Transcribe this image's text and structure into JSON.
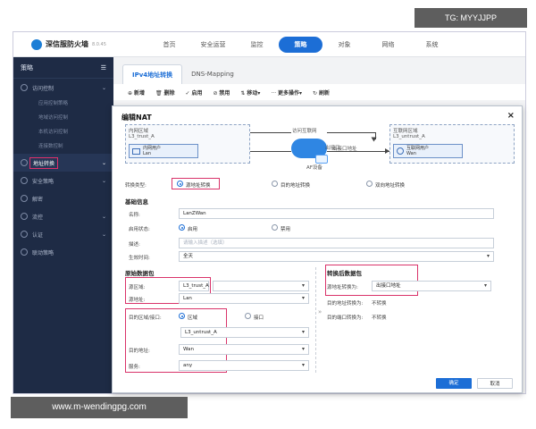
{
  "watermarks": {
    "top_right": "TG: MYYJJPP",
    "bottom_left": "www.m-wendingpg.com"
  },
  "app": {
    "title": "深信服防火墙",
    "version": "8.0.45"
  },
  "topnav": [
    "首页",
    "安全运营",
    "监控",
    "策略",
    "对象",
    "网络",
    "系统"
  ],
  "sidebar": {
    "title": "策略",
    "items": [
      {
        "label": "访问控制",
        "icon": "shield-icon"
      },
      {
        "label": "地址转换",
        "icon": "swap-icon"
      },
      {
        "label": "安全策略",
        "icon": "lock-icon"
      },
      {
        "label": "解密",
        "icon": "key-icon"
      },
      {
        "label": "流控",
        "icon": "gauge-icon"
      },
      {
        "label": "认证",
        "icon": "user-icon"
      },
      {
        "label": "联动策略",
        "icon": "link-icon"
      }
    ],
    "subitems": [
      "应用控制策略",
      "地域访问控制",
      "本机访问控制",
      "连接数控制"
    ]
  },
  "tabs": [
    "IPv4地址转换",
    "DNS-Mapping"
  ],
  "toolbar": [
    "新增",
    "删除",
    "启用",
    "禁用",
    "移动",
    "更多操作",
    "刷新"
  ],
  "modal": {
    "title": "编辑NAT",
    "close": "×",
    "diagram": {
      "src_zone_title": "内网区域",
      "src_zone": "L3_trust_A",
      "src_user": "内网用户",
      "src_user_val": "Lan",
      "dst_zone_title": "互联网区域",
      "dst_zone": "L3_untrust_A",
      "dst_user": "互联网用户",
      "dst_user_val": "Wan",
      "top_text": "访问互联网",
      "outlet": "出接口",
      "device": "AF设备",
      "out_addr": "出接口地址"
    },
    "conversion": {
      "label": "转换类型:",
      "options": [
        "源地址转换",
        "目的地址转换",
        "双向地址转换"
      ],
      "selected": "源地址转换"
    },
    "basic": {
      "section": "基础信息",
      "name_label": "名称:",
      "name_value": "LanZWan",
      "status_label": "启用状态:",
      "status_options": [
        "启用",
        "禁用"
      ],
      "desc_label": "描述:",
      "desc_placeholder": "请输入描述（选填）",
      "time_label": "生效时间:",
      "time_value": "全天"
    },
    "original": {
      "section": "原始数据包",
      "src_zone_label": "源区域:",
      "src_zone_value": "L3_trust_A",
      "src_addr_label": "源地址:",
      "src_addr_value": "Lan",
      "dst_type_label": "目的区域/接口:",
      "dst_type_options": [
        "区域",
        "接口"
      ],
      "dst_zone_value": "L3_untrust_A",
      "dst_addr_label": "目的地址:",
      "dst_addr_value": "Wan",
      "service_label": "服务:",
      "service_value": "any"
    },
    "translated": {
      "section": "转换后数据包",
      "src_conv_label": "源地址转换为:",
      "src_conv_value": "出接口地址",
      "dst_addr_label": "目的地址转换为:",
      "dst_addr_value": "不转换",
      "dst_port_label": "目的端口转换为:",
      "dst_port_value": "不转换"
    },
    "buttons": {
      "ok": "确定",
      "cancel": "取消"
    }
  }
}
